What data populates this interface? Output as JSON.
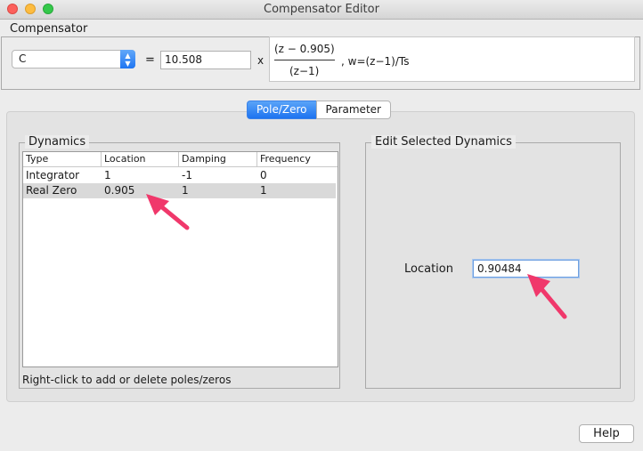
{
  "window": {
    "title": "Compensator Editor"
  },
  "compensator": {
    "group_title": "Compensator",
    "name_select": "C",
    "equals": "=",
    "gain": "10.508",
    "times": "x",
    "numerator": "(z − 0.905)",
    "denominator": "(z−1)",
    "w_definition": ", w=(z−1)/Ts"
  },
  "tabs": [
    {
      "label": "Pole/Zero",
      "active": true
    },
    {
      "label": "Parameter",
      "active": false
    }
  ],
  "dynamics": {
    "title": "Dynamics",
    "columns": [
      "Type",
      "Location",
      "Damping",
      "Frequency"
    ],
    "rows": [
      {
        "type": "Integrator",
        "location": "1",
        "damping": "-1",
        "frequency": "0",
        "selected": false
      },
      {
        "type": "Real Zero",
        "location": "0.905",
        "damping": "1",
        "frequency": "1",
        "selected": true
      }
    ],
    "hint": "Right-click to add or delete poles/zeros"
  },
  "edit_dynamics": {
    "title": "Edit Selected Dynamics",
    "location_label": "Location",
    "location_value": "0.90484"
  },
  "help_button": "Help",
  "colors": {
    "accent": "#1d73f0",
    "annotation_arrow": "#f0386b",
    "selected_row": "#d9d9d9"
  }
}
